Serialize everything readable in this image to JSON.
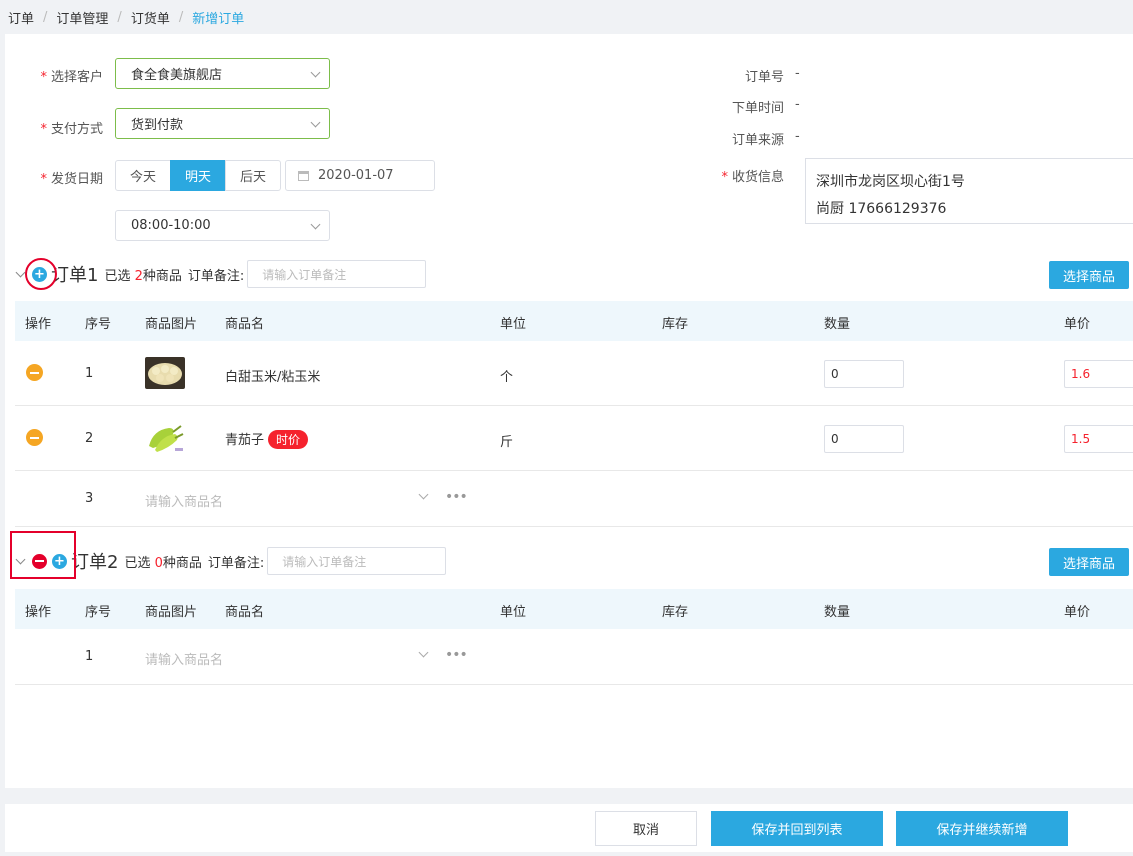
{
  "breadcrumb": [
    "订单",
    "订单管理",
    "订货单",
    "新增订单"
  ],
  "form": {
    "customer_label": "选择客户",
    "customer_value": "食全食美旗舰店",
    "payment_label": "支付方式",
    "payment_value": "货到付款",
    "ship_label": "发货日期",
    "date_options": [
      "今天",
      "明天",
      "后天"
    ],
    "date_selected": "明天",
    "date_value": "2020-01-07",
    "time_value": "08:00-10:00"
  },
  "info": {
    "order_no_label": "订单号",
    "order_no_value": "-",
    "order_time_label": "下单时间",
    "order_time_value": "-",
    "order_source_label": "订单来源",
    "order_source_value": "-",
    "receive_label": "收货信息",
    "address": "深圳市龙岗区坝心街1号",
    "contact": "尚厨 17666129376"
  },
  "table_headers": [
    "操作",
    "序号",
    "商品图片",
    "商品名",
    "单位",
    "库存",
    "数量",
    "单价"
  ],
  "orders": [
    {
      "title": "订单1",
      "meta_prefix": "已选",
      "count": "2",
      "meta_suffix": "种商品",
      "remark_label": "订单备注:",
      "remark_placeholder": "请输入订单备注",
      "pick_label": "选择商品",
      "rows": [
        {
          "index": "1",
          "name": "白甜玉米/粘玉米",
          "tag": "",
          "unit": "个",
          "qty": "0",
          "price": "1.6"
        },
        {
          "index": "2",
          "name": "青茄子",
          "tag": "时价",
          "unit": "斤",
          "qty": "0",
          "price": "1.5"
        }
      ],
      "new_row_index": "3",
      "new_row_placeholder": "请输入商品名"
    },
    {
      "title": "订单2",
      "meta_prefix": "已选",
      "count": "0",
      "meta_suffix": "种商品",
      "remark_label": "订单备注:",
      "remark_placeholder": "请输入订单备注",
      "pick_label": "选择商品",
      "new_row_index": "1",
      "new_row_placeholder": "请输入商品名"
    }
  ],
  "footer": {
    "cancel": "取消",
    "save_back": "保存并回到列表",
    "save_continue": "保存并继续新增"
  },
  "colors": {
    "accent": "#2ba8e0",
    "required": "#f5222d",
    "minus_orange": "#f5a623",
    "delete_red": "#e4002b",
    "select_border_green": "#7cbd4a"
  },
  "icons": [
    "chevron-down-icon",
    "calendar-icon",
    "add-circle-icon",
    "remove-circle-icon",
    "more-icon"
  ]
}
